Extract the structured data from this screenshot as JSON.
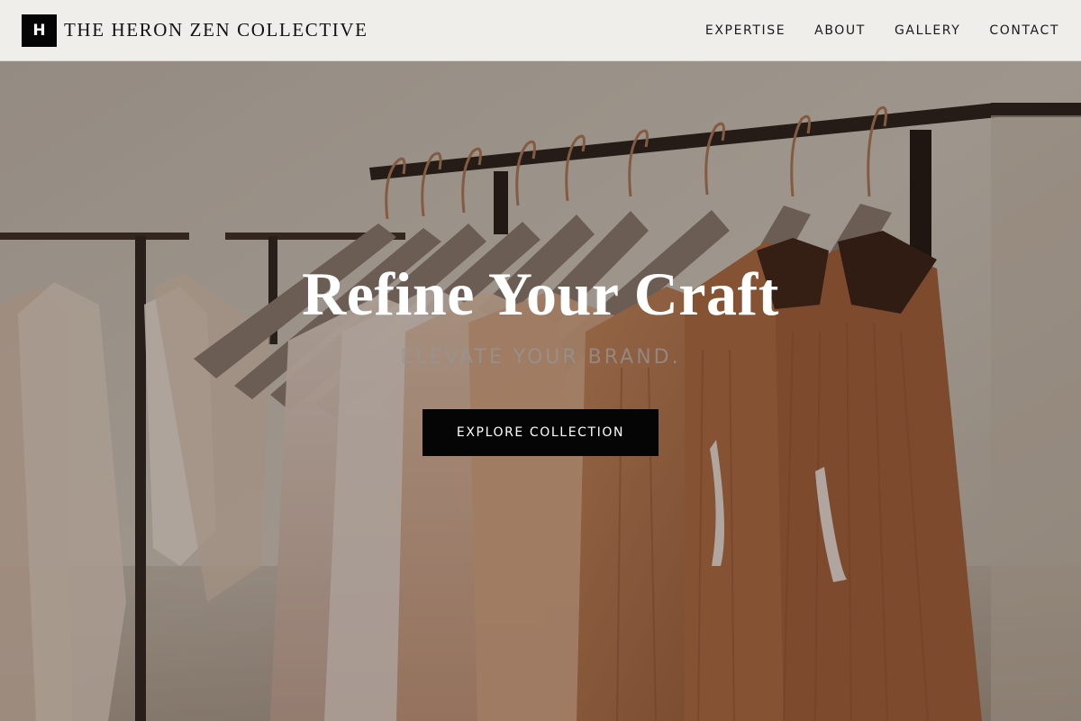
{
  "header": {
    "logo_letter": "H",
    "brand_name": "THE HERON ZEN COLLECTIVE",
    "nav": [
      {
        "label": "EXPERTISE"
      },
      {
        "label": "ABOUT"
      },
      {
        "label": "GALLERY"
      },
      {
        "label": "CONTACT"
      }
    ]
  },
  "hero": {
    "title": "Refine Your Craft",
    "subtitle": "ELEVATE YOUR BRAND.",
    "button_label": "EXPLORE COLLECTION",
    "image_subject": "clothing-rack-photo"
  },
  "colors": {
    "header_bg": "#efeeea",
    "button_bg": "#050505",
    "title_text": "#ffffff"
  }
}
